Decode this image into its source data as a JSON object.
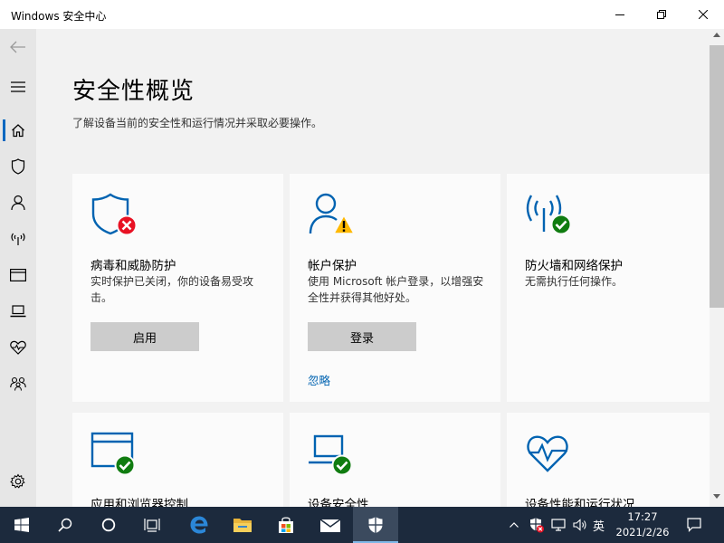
{
  "window": {
    "title": "Windows 安全中心"
  },
  "nav": {
    "items": [
      {
        "icon": "back-arrow-icon"
      },
      {
        "icon": "hamburger-menu-icon"
      },
      {
        "icon": "home-icon",
        "active": true
      },
      {
        "icon": "shield-icon"
      },
      {
        "icon": "person-icon"
      },
      {
        "icon": "wireless-antenna-icon"
      },
      {
        "icon": "app-browser-window-icon"
      },
      {
        "icon": "laptop-icon"
      },
      {
        "icon": "heart-pulse-icon"
      },
      {
        "icon": "family-icon"
      },
      {
        "icon": "gear-icon"
      }
    ]
  },
  "main": {
    "title": "安全性概览",
    "subtitle": "了解设备当前的安全性和运行情况并采取必要操作。",
    "cards": [
      {
        "title": "病毒和威胁防护",
        "desc": "实时保护已关闭，你的设备易受攻击。",
        "button": "启用",
        "status": "error",
        "icon": "shield-icon"
      },
      {
        "title": "帐户保护",
        "desc": "使用 Microsoft 帐户登录，以增强安全性并获得其他好处。",
        "button": "登录",
        "link": "忽略",
        "status": "warning",
        "icon": "person-icon"
      },
      {
        "title": "防火墙和网络保护",
        "desc": "无需执行任何操作。",
        "status": "ok",
        "icon": "wireless-antenna-icon"
      },
      {
        "title": "应用和浏览器控制",
        "status": "ok",
        "icon": "app-browser-window-icon"
      },
      {
        "title": "设备安全性",
        "status": "ok",
        "icon": "laptop-icon"
      },
      {
        "title": "设备性能和运行状况",
        "status": "ok",
        "icon": "heart-pulse-icon"
      }
    ]
  },
  "taskbar": {
    "language": "英",
    "time": "17:27",
    "date": "2021/2/26",
    "apps": [
      "start-icon",
      "search-icon",
      "cortana-icon",
      "task-view-icon",
      "edge-icon",
      "file-explorer-icon",
      "store-icon",
      "mail-icon",
      "windows-security-icon"
    ]
  },
  "colors": {
    "accent": "#0067c0",
    "icon_blue": "#0063b1",
    "error": "#e81123",
    "warning": "#ffb900",
    "ok": "#107c10",
    "taskbar": "#1c2a3d"
  }
}
